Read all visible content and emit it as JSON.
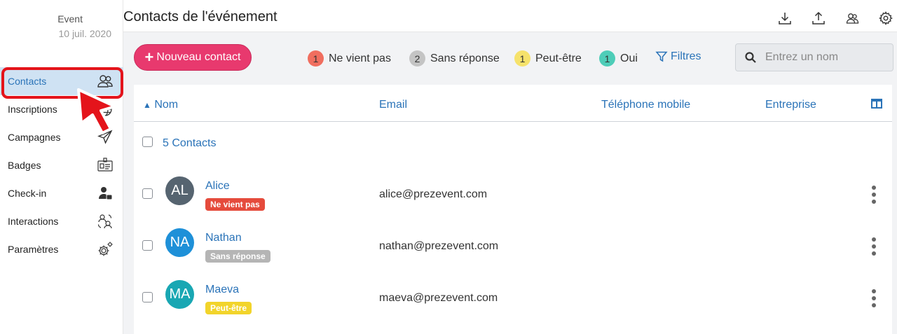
{
  "event": {
    "name": "Event",
    "date": "10 juil. 2020"
  },
  "sidebar": {
    "items": [
      {
        "label": "Contacts",
        "icon": "contacts-icon"
      },
      {
        "label": "Inscriptions",
        "icon": "globe-icon"
      },
      {
        "label": "Campagnes",
        "icon": "paper-plane-icon"
      },
      {
        "label": "Badges",
        "icon": "badge-icon"
      },
      {
        "label": "Check-in",
        "icon": "checkin-user-icon"
      },
      {
        "label": "Interactions",
        "icon": "interactions-icon"
      },
      {
        "label": "Paramètres",
        "icon": "settings-gears-icon"
      }
    ]
  },
  "header": {
    "title": "Contacts de l'événement"
  },
  "toolbar": {
    "new_contact_label": "Nouveau contact",
    "filters": [
      {
        "count": "1",
        "label": "Ne vient pas",
        "color": "#f06e5f"
      },
      {
        "count": "2",
        "label": "Sans réponse",
        "color": "#c4c4c4"
      },
      {
        "count": "1",
        "label": "Peut-être",
        "color": "#f6e26b"
      },
      {
        "count": "1",
        "label": "Oui",
        "color": "#4ecdb8"
      }
    ],
    "filters_link": "Filtres",
    "search_placeholder": "Entrez un nom"
  },
  "table": {
    "columns": [
      "Nom",
      "Email",
      "Téléphone mobile",
      "Entreprise"
    ],
    "sort_indicator": "▲",
    "count_label": "5 Contacts",
    "rows": [
      {
        "initials": "AL",
        "name": "Alice",
        "status": "Ne vient pas",
        "status_color": "#e54b3c",
        "avatar_color": "#566470",
        "email": "alice@prezevent.com"
      },
      {
        "initials": "NA",
        "name": "Nathan",
        "status": "Sans réponse",
        "status_color": "#b5b5b5",
        "avatar_color": "#1e90d8",
        "email": "nathan@prezevent.com"
      },
      {
        "initials": "MA",
        "name": "Maeva",
        "status": "Peut-être",
        "status_color": "#f2d42b",
        "avatar_color": "#19a7b3",
        "email": "maeva@prezevent.com"
      }
    ]
  },
  "colors": {
    "accent": "#2a73b8",
    "brand": "#e8396e",
    "highlight": "#e4141b"
  }
}
